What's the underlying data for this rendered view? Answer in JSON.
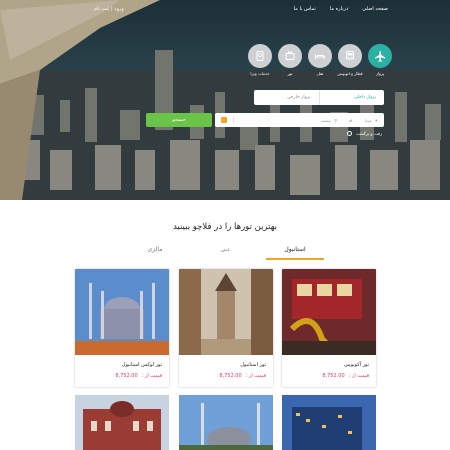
{
  "header": {
    "nav": [
      "صفحه اصلی",
      "درباره ما",
      "تماس با ما"
    ],
    "login": "ورود | ثبت نام"
  },
  "services": [
    {
      "label": "پرواز",
      "icon": "airplane-icon",
      "active": true
    },
    {
      "label": "قطار و اتوبوس",
      "icon": "bus-icon",
      "active": false
    },
    {
      "label": "هتل",
      "icon": "bed-icon",
      "active": false
    },
    {
      "label": "تور",
      "icon": "suitcase-icon",
      "active": false
    },
    {
      "label": "خدمات ویزا",
      "icon": "passport-icon",
      "active": false
    }
  ],
  "search": {
    "tab_domestic": "پرواز داخلی",
    "tab_foreign": "پرواز خارجی",
    "origin": "مبدا",
    "destination": "مقصد",
    "date": "",
    "submit": "جستجو",
    "roundtrip": "رفت و برگشت"
  },
  "section": {
    "title": "بهترین تورها را در فلاچو ببینید",
    "tabs": [
      "استانبول",
      "دبی",
      "مالزی"
    ]
  },
  "cards": [
    {
      "name": "تور آکونومی",
      "price_label": "قیمت از :",
      "price": "8,752.00"
    },
    {
      "name": "تور استانبول",
      "price_label": "قیمت از :",
      "price": "8,752.00"
    },
    {
      "name": "تور لوکس استانبول",
      "price_label": "قیمت از :",
      "price": "8,752.00"
    }
  ],
  "colors": {
    "accent": "#2bb1a4",
    "green": "#6ac44a",
    "price": "#e8336f",
    "tab_underline": "#f5a623"
  }
}
